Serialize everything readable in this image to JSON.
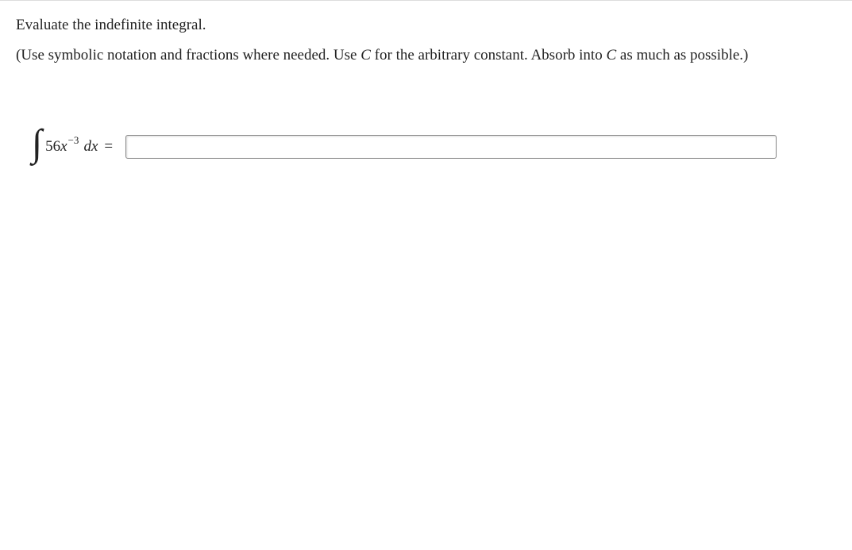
{
  "instructions": {
    "line1": "Evaluate the indefinite integral.",
    "line2_pre": "(Use symbolic notation and fractions where needed. Use ",
    "line2_c1": "C",
    "line2_mid": " for the arbitrary constant. Absorb into ",
    "line2_c2": "C",
    "line2_post": " as much as possible.)"
  },
  "integral": {
    "sign": "∫",
    "coef": "56",
    "var": "x",
    "exp": "−3",
    "dvar": "dx",
    "equals": "="
  },
  "answer": {
    "value": ""
  }
}
